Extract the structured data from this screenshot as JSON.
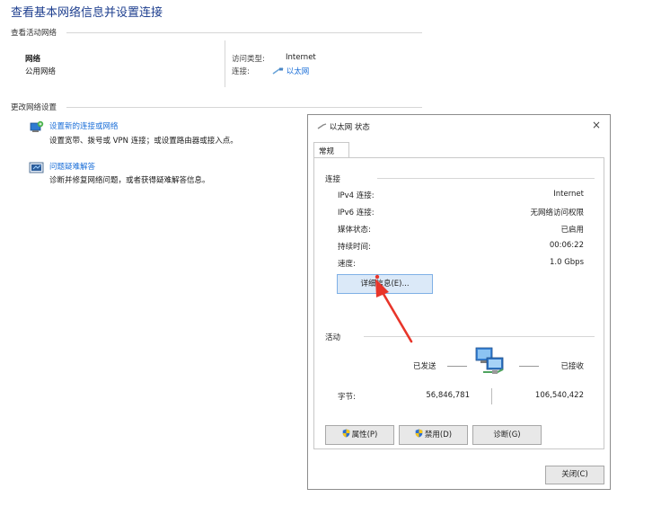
{
  "page": {
    "title": "查看基本网络信息并设置连接",
    "active_networks_label": "查看活动网络",
    "network_name": "网络",
    "network_type": "公用网络",
    "access_type_label": "访问类型:",
    "access_type_value": "Internet",
    "connection_label": "连接:",
    "connection_value": "以太网",
    "change_settings_label": "更改网络设置",
    "actions": [
      {
        "title": "设置新的连接或网络",
        "desc": "设置宽带、拨号或 VPN 连接；或设置路由器或接入点。",
        "icon": "network-setup-icon"
      },
      {
        "title": "问题疑难解答",
        "desc": "诊断并修复网络问题，或者获得疑难解答信息。",
        "icon": "troubleshoot-icon"
      }
    ]
  },
  "dialog": {
    "title": "以太网 状态",
    "close": "×",
    "tab": "常规",
    "connection_group": "连接",
    "rows": [
      {
        "label": "IPv4 连接:",
        "value": "Internet"
      },
      {
        "label": "IPv6 连接:",
        "value": "无网络访问权限"
      },
      {
        "label": "媒体状态:",
        "value": "已启用"
      },
      {
        "label": "持续时间:",
        "value": "00:06:22"
      },
      {
        "label": "速度:",
        "value": "1.0 Gbps"
      }
    ],
    "details_button": "详细信息(E)...",
    "activity_group": "活动",
    "sent_label": "已发送",
    "received_label": "已接收",
    "bytes_label": "字节:",
    "bytes_sent": "56,846,781",
    "bytes_received": "106,540,422",
    "properties_button": "属性(P)",
    "disable_button": "禁用(D)",
    "diagnose_button": "诊断(G)",
    "close_button": "关闭(C)"
  },
  "colors": {
    "title_blue": "#1e3f8f",
    "link_blue": "#1a6ed8",
    "arrow_red": "#e8352a"
  }
}
